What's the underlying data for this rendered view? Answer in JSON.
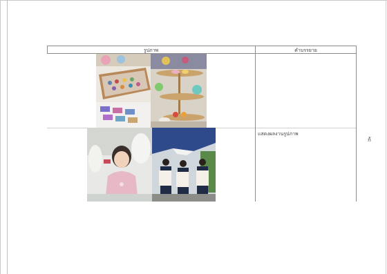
{
  "table": {
    "headers": [
      "รูปภาพ",
      "คำบรรยาย"
    ],
    "rows": [
      {
        "caption": "",
        "photos": [
          "handicraft-stall-photo",
          "cake-stand-crafts-photo"
        ]
      },
      {
        "caption": "แสดงผลงานรูปภาพ",
        "photos": [
          "girl-holding-craft-photo",
          "students-with-tote-bags-photo"
        ]
      }
    ]
  },
  "side_note": "ก้"
}
